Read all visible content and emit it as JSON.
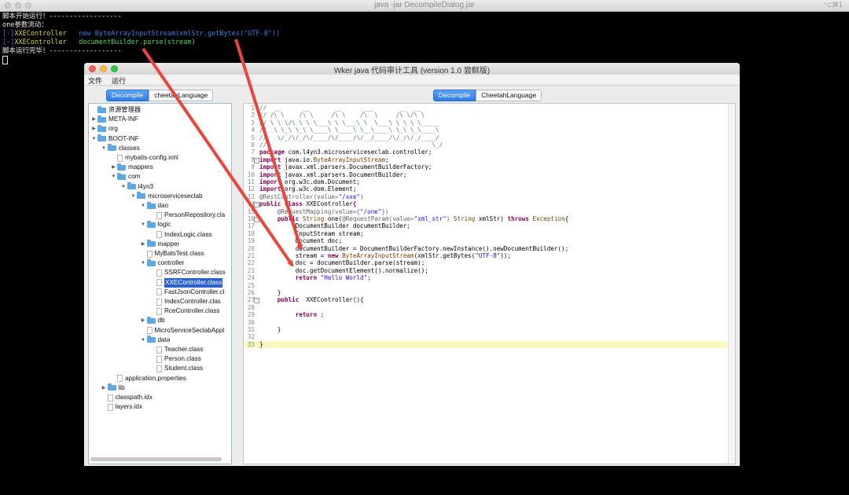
{
  "terminal": {
    "window_title": "java -jar DecompileDialog.jar",
    "shortcut": "⌥⌘1",
    "lines": [
      {
        "parts": [
          {
            "t": "脚本开始运行！------------------",
            "c": "c-white"
          }
        ]
      },
      {
        "parts": [
          {
            "t": "one参数流动：",
            "c": "c-white"
          }
        ]
      },
      {
        "parts": [
          {
            "t": "[-]",
            "c": "c-blue"
          },
          {
            "t": "XXEController",
            "c": "c-yellow"
          },
          {
            "t": "   new ByteArrayInputStream(xmlStr.getBytes(\"UTF-8\"))",
            "c": "c-blue"
          }
        ]
      },
      {
        "parts": [
          {
            "t": "[-]",
            "c": "c-blue"
          },
          {
            "t": "XXEController",
            "c": "c-yellow"
          },
          {
            "t": "   documentBuilder.parse(stream)",
            "c": "c-green"
          }
        ]
      },
      {
        "parts": [
          {
            "t": "脚本运行完毕！------------------",
            "c": "c-white"
          }
        ]
      }
    ]
  },
  "app": {
    "window_title": "Wker java 代码审计工具 (version 1.0 尝鲜版)",
    "menu": {
      "file": "文件",
      "run": "运行"
    },
    "left_tabs": [
      "Decompile",
      "cheetahLanguage"
    ],
    "right_tabs": [
      "Decompile",
      "CheetahLanguage"
    ],
    "tree": [
      {
        "label": "资源管理器",
        "type": "folder",
        "depth": 0,
        "tog": ""
      },
      {
        "label": "META-INF",
        "type": "folder",
        "depth": 0,
        "tog": "▶"
      },
      {
        "label": "org",
        "type": "folder",
        "depth": 0,
        "tog": "▶"
      },
      {
        "label": "BOOT-INF",
        "type": "folder",
        "depth": 0,
        "tog": "▼"
      },
      {
        "label": "classes",
        "type": "folder",
        "depth": 1,
        "tog": "▼"
      },
      {
        "label": "mybatis-config.xml",
        "type": "file",
        "depth": 2,
        "tog": ""
      },
      {
        "label": "mappers",
        "type": "folder",
        "depth": 2,
        "tog": "▶"
      },
      {
        "label": "com",
        "type": "folder",
        "depth": 2,
        "tog": "▼"
      },
      {
        "label": "l4yn3",
        "type": "folder",
        "depth": 3,
        "tog": "▼"
      },
      {
        "label": "microserviceseclab",
        "type": "folder",
        "depth": 4,
        "tog": "▼"
      },
      {
        "label": "dao",
        "type": "folder",
        "depth": 5,
        "tog": "▼"
      },
      {
        "label": "PersonRepository.cla",
        "type": "file",
        "depth": 6,
        "tog": ""
      },
      {
        "label": "logic",
        "type": "folder",
        "depth": 5,
        "tog": "▼"
      },
      {
        "label": "IndexLogic.class",
        "type": "file",
        "depth": 6,
        "tog": ""
      },
      {
        "label": "mapper",
        "type": "folder",
        "depth": 5,
        "tog": "▶"
      },
      {
        "label": "MyBatsTest.class",
        "type": "file",
        "depth": 5,
        "tog": ""
      },
      {
        "label": "controller",
        "type": "folder",
        "depth": 5,
        "tog": "▼"
      },
      {
        "label": "SSRFController.class",
        "type": "file",
        "depth": 6,
        "tog": ""
      },
      {
        "label": "XXEController.class",
        "type": "file",
        "depth": 6,
        "tog": "",
        "selected": true
      },
      {
        "label": "FastJsonController.cl",
        "type": "file",
        "depth": 6,
        "tog": ""
      },
      {
        "label": "IndexController.clas",
        "type": "file",
        "depth": 6,
        "tog": ""
      },
      {
        "label": "RceController.class",
        "type": "file",
        "depth": 6,
        "tog": ""
      },
      {
        "label": "db",
        "type": "folder",
        "depth": 5,
        "tog": "▶"
      },
      {
        "label": "MicroServiceSeclabAppl",
        "type": "file",
        "depth": 5,
        "tog": ""
      },
      {
        "label": "data",
        "type": "folder",
        "depth": 5,
        "tog": "▼"
      },
      {
        "label": "Teacher.class",
        "type": "file",
        "depth": 6,
        "tog": ""
      },
      {
        "label": "Person.class",
        "type": "file",
        "depth": 6,
        "tog": ""
      },
      {
        "label": "Student.class",
        "type": "file",
        "depth": 6,
        "tog": ""
      },
      {
        "label": "application.properties",
        "type": "file",
        "depth": 2,
        "tog": ""
      },
      {
        "label": "lib",
        "type": "folder",
        "depth": 1,
        "tog": "▶"
      },
      {
        "label": "classpath.idx",
        "type": "file",
        "depth": 1,
        "tog": ""
      },
      {
        "label": "layers.idx",
        "type": "file",
        "depth": 1,
        "tog": ""
      }
    ],
    "code": [
      {
        "n": "1",
        "s": [
          [
            "cmt",
            "//  __      __       __      ___       __  __       "
          ]
        ]
      },
      {
        "n": "2",
        "s": [
          [
            "cmt",
            "// /\\ \\    /\\ \\     /\\ \\    /\\  \\     /\\ \\/\\ \\      "
          ]
        ]
      },
      {
        "n": "3",
        "s": [
          [
            "cmt",
            "// \\ \\ \\/\\ \\ \\ \\___\\ \\ \\___\\ \\  \\___\\ \\ \\ \\ \\_____ "
          ]
        ]
      },
      {
        "n": "4",
        "s": [
          [
            "cmt",
            "//  \\ \\_\\ \\_\\ \\____\\ \\____\\ \\__\\____\\ \\_\\ \\_\\____\\"
          ]
        ]
      },
      {
        "n": "5",
        "s": [
          [
            "cmt",
            "//   \\/_/\\/_/\\/____/\\/____/\\/__/____/\\/_/\\/_/____/"
          ]
        ]
      },
      {
        "n": "6",
        "s": [
          [
            "cmt",
            "//                                              \\_/ "
          ]
        ]
      },
      {
        "n": "7",
        "s": [
          [
            "kw",
            "package "
          ],
          [
            "",
            "com.l4yn3.microserviceseclab.controller;"
          ]
        ]
      },
      {
        "n": "8",
        "s": [
          [
            "kw",
            "import "
          ],
          [
            "",
            "java.io."
          ],
          [
            "typ",
            "ByteArrayInputStream"
          ],
          [
            "",
            ";"
          ]
        ],
        "fold": "−"
      },
      {
        "n": "9",
        "s": [
          [
            "kw",
            "import "
          ],
          [
            "",
            "javax.xml.parsers.DocumentBuilderFactory;"
          ]
        ]
      },
      {
        "n": "10",
        "s": [
          [
            "kw",
            "import "
          ],
          [
            "",
            "javax.xml.parsers.DocumentBuilder;"
          ]
        ]
      },
      {
        "n": "11",
        "s": [
          [
            "kw",
            "import "
          ],
          [
            "",
            "org.w3c.dom.Document;"
          ]
        ]
      },
      {
        "n": "12",
        "s": [
          [
            "kw",
            "import "
          ],
          [
            "",
            "org.w3c.dom.Element;"
          ]
        ]
      },
      {
        "n": "13",
        "s": [
          [
            "ann",
            "@RestController(value="
          ],
          [
            "str",
            "\"/xxe\""
          ],
          [
            "ann",
            ")"
          ]
        ]
      },
      {
        "n": "14",
        "s": [
          [
            "kw",
            "public class "
          ],
          [
            "",
            "XXEController"
          ],
          [
            "kw",
            "{"
          ]
        ],
        "fold": "−"
      },
      {
        "n": "15",
        "s": [
          [
            "",
            "     "
          ],
          [
            "ann",
            "@RequestMapping(value={"
          ],
          [
            "str",
            "\"/one\""
          ],
          [
            "ann",
            "})"
          ]
        ]
      },
      {
        "n": "16",
        "s": [
          [
            "",
            "     "
          ],
          [
            "kw",
            "public "
          ],
          [
            "typ",
            "String "
          ],
          [
            "",
            "one("
          ],
          [
            "ann",
            "@RequestParam(value="
          ],
          [
            "str",
            "\"xml_str\""
          ],
          [
            "ann",
            ")"
          ],
          [
            "typ",
            " String "
          ],
          [
            "",
            "xmlStr) "
          ],
          [
            "kw",
            "throws "
          ],
          [
            "typ",
            "Exception"
          ],
          [
            "",
            "{"
          ]
        ],
        "fold": "−"
      },
      {
        "n": "17",
        "s": [
          [
            "",
            "          DocumentBuilder documentBuilder;"
          ]
        ]
      },
      {
        "n": "18",
        "s": [
          [
            "",
            "          InputStream stream;"
          ]
        ]
      },
      {
        "n": "19",
        "s": [
          [
            "",
            "          Document doc;"
          ]
        ]
      },
      {
        "n": "20",
        "s": [
          [
            "",
            "          documentBuilder = DocumentBuilderFactory.newInstance().newDocumentBuilder();"
          ]
        ]
      },
      {
        "n": "21",
        "s": [
          [
            "",
            "          stream = "
          ],
          [
            "kw",
            "new "
          ],
          [
            "typ",
            "ByteArrayInputStream"
          ],
          [
            "",
            "(xmlStr.getBytes("
          ],
          [
            "str",
            "\"UTF-8\""
          ],
          [
            "",
            "));"
          ]
        ]
      },
      {
        "n": "22",
        "s": [
          [
            "",
            "          doc = documentBuilder.parse(stream);"
          ]
        ]
      },
      {
        "n": "23",
        "s": [
          [
            "",
            "          doc.getDocumentElement().normalize();"
          ]
        ]
      },
      {
        "n": "24",
        "s": [
          [
            "",
            "          "
          ],
          [
            "kw",
            "return "
          ],
          [
            "str",
            "\"Hello World\""
          ],
          [
            "",
            ";"
          ]
        ]
      },
      {
        "n": "25",
        "s": [
          [
            "",
            ""
          ]
        ]
      },
      {
        "n": "26",
        "s": [
          [
            "",
            "     }"
          ]
        ]
      },
      {
        "n": "27",
        "s": [
          [
            "",
            "     "
          ],
          [
            "kw",
            "public  "
          ],
          [
            "",
            "XXEController(){"
          ]
        ],
        "fold": "−"
      },
      {
        "n": "28",
        "s": [
          [
            "",
            ""
          ]
        ]
      },
      {
        "n": "29",
        "s": [
          [
            "",
            "          "
          ],
          [
            "kw",
            "return "
          ],
          [
            "",
            ";"
          ]
        ]
      },
      {
        "n": "30",
        "s": [
          [
            "",
            ""
          ]
        ]
      },
      {
        "n": "31",
        "s": [
          [
            "",
            "     }"
          ]
        ]
      },
      {
        "n": "32",
        "s": [
          [
            "",
            ""
          ]
        ]
      },
      {
        "n": "33",
        "s": [
          [
            "",
            "}"
          ]
        ],
        "highlight": true
      }
    ]
  },
  "colors": {
    "arrow": "#e8453c",
    "selection": "#2a62cf",
    "tab_active": "#2c7ce8"
  }
}
